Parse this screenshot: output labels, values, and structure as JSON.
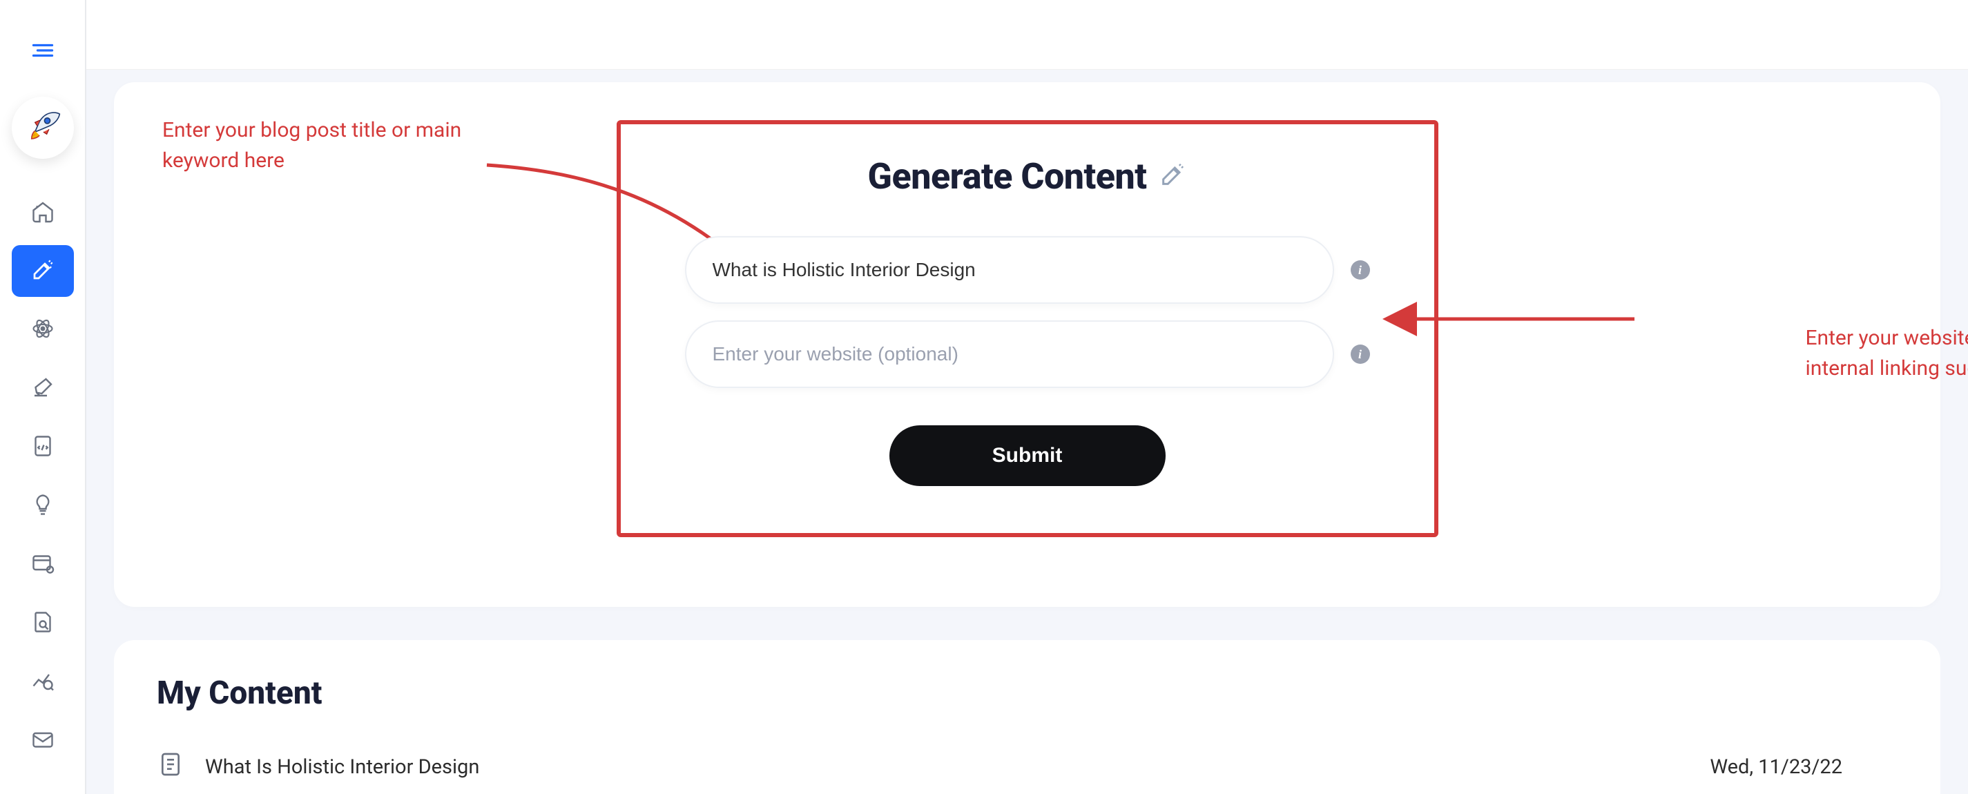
{
  "sidebar": {
    "items": [
      {
        "name": "home"
      },
      {
        "name": "content-gen",
        "active": true
      },
      {
        "name": "atom"
      },
      {
        "name": "highlight"
      },
      {
        "name": "code"
      },
      {
        "name": "idea"
      },
      {
        "name": "card"
      },
      {
        "name": "doc-search"
      },
      {
        "name": "analytics"
      },
      {
        "name": "envelope"
      }
    ]
  },
  "generate": {
    "title": "Generate Content",
    "title_input_value": "What is Holistic Interior Design",
    "website_input_placeholder": "Enter your website (optional)",
    "submit_label": "Submit",
    "info_glyph": "i"
  },
  "callouts": {
    "left_text": "Enter your blog post title or main keyword here",
    "right_text": "Enter your website to receive internal linking suggestions"
  },
  "my_content": {
    "heading": "My Content",
    "rows": [
      {
        "title": "What Is Holistic Interior Design",
        "date": "Wed, 11/23/22"
      }
    ]
  }
}
